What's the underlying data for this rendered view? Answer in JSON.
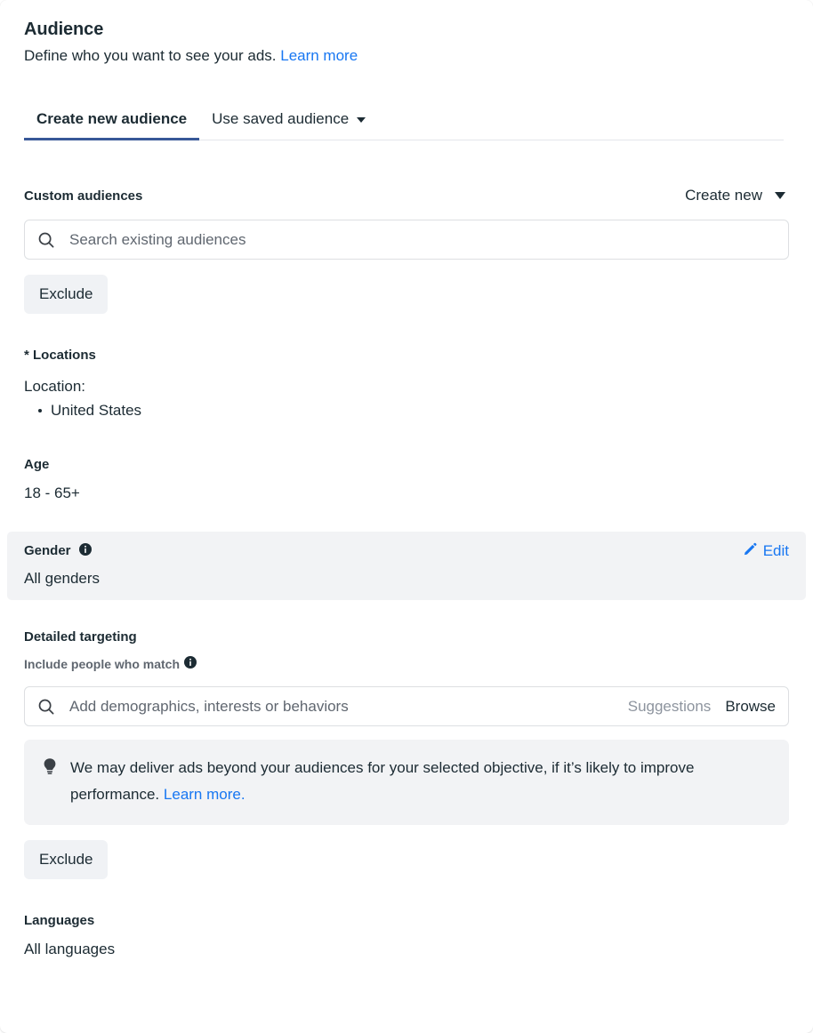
{
  "header": {
    "title": "Audience",
    "subtitle": "Define who you want to see your ads.",
    "learn_more": "Learn more"
  },
  "tabs": [
    {
      "label": "Create new audience",
      "active": true,
      "has_caret": false
    },
    {
      "label": "Use saved audience",
      "active": false,
      "has_caret": true
    }
  ],
  "custom_audiences": {
    "label": "Custom audiences",
    "create_new_label": "Create new",
    "search_placeholder": "Search existing audiences",
    "search_value": "",
    "exclude_label": "Exclude"
  },
  "locations": {
    "label": "* Locations",
    "caption": "Location:",
    "items": [
      "United States"
    ]
  },
  "age": {
    "label": "Age",
    "value": "18 - 65+"
  },
  "gender": {
    "label": "Gender",
    "value": "All genders",
    "edit_label": "Edit"
  },
  "detailed_targeting": {
    "label": "Detailed targeting",
    "sub_label": "Include people who match",
    "search_placeholder": "Add demographics, interests or behaviors",
    "search_value": "",
    "suggestions_label": "Suggestions",
    "browse_label": "Browse",
    "tip_text": "We may deliver ads beyond your audiences for your selected objective, if it’s likely to improve performance.",
    "tip_link": "Learn more.",
    "exclude_label": "Exclude"
  },
  "languages": {
    "label": "Languages",
    "value": "All languages"
  },
  "icons": {
    "search": "search-icon",
    "info": "info-icon",
    "pencil": "pencil-icon",
    "bulb": "lightbulb-icon",
    "caret": "chevron-down-icon"
  },
  "colors": {
    "link": "#1877f2",
    "tab_underline": "#385898",
    "text": "#1c2b33",
    "muted": "#606770",
    "panel": "#f2f3f5",
    "button": "#f0f2f5"
  }
}
